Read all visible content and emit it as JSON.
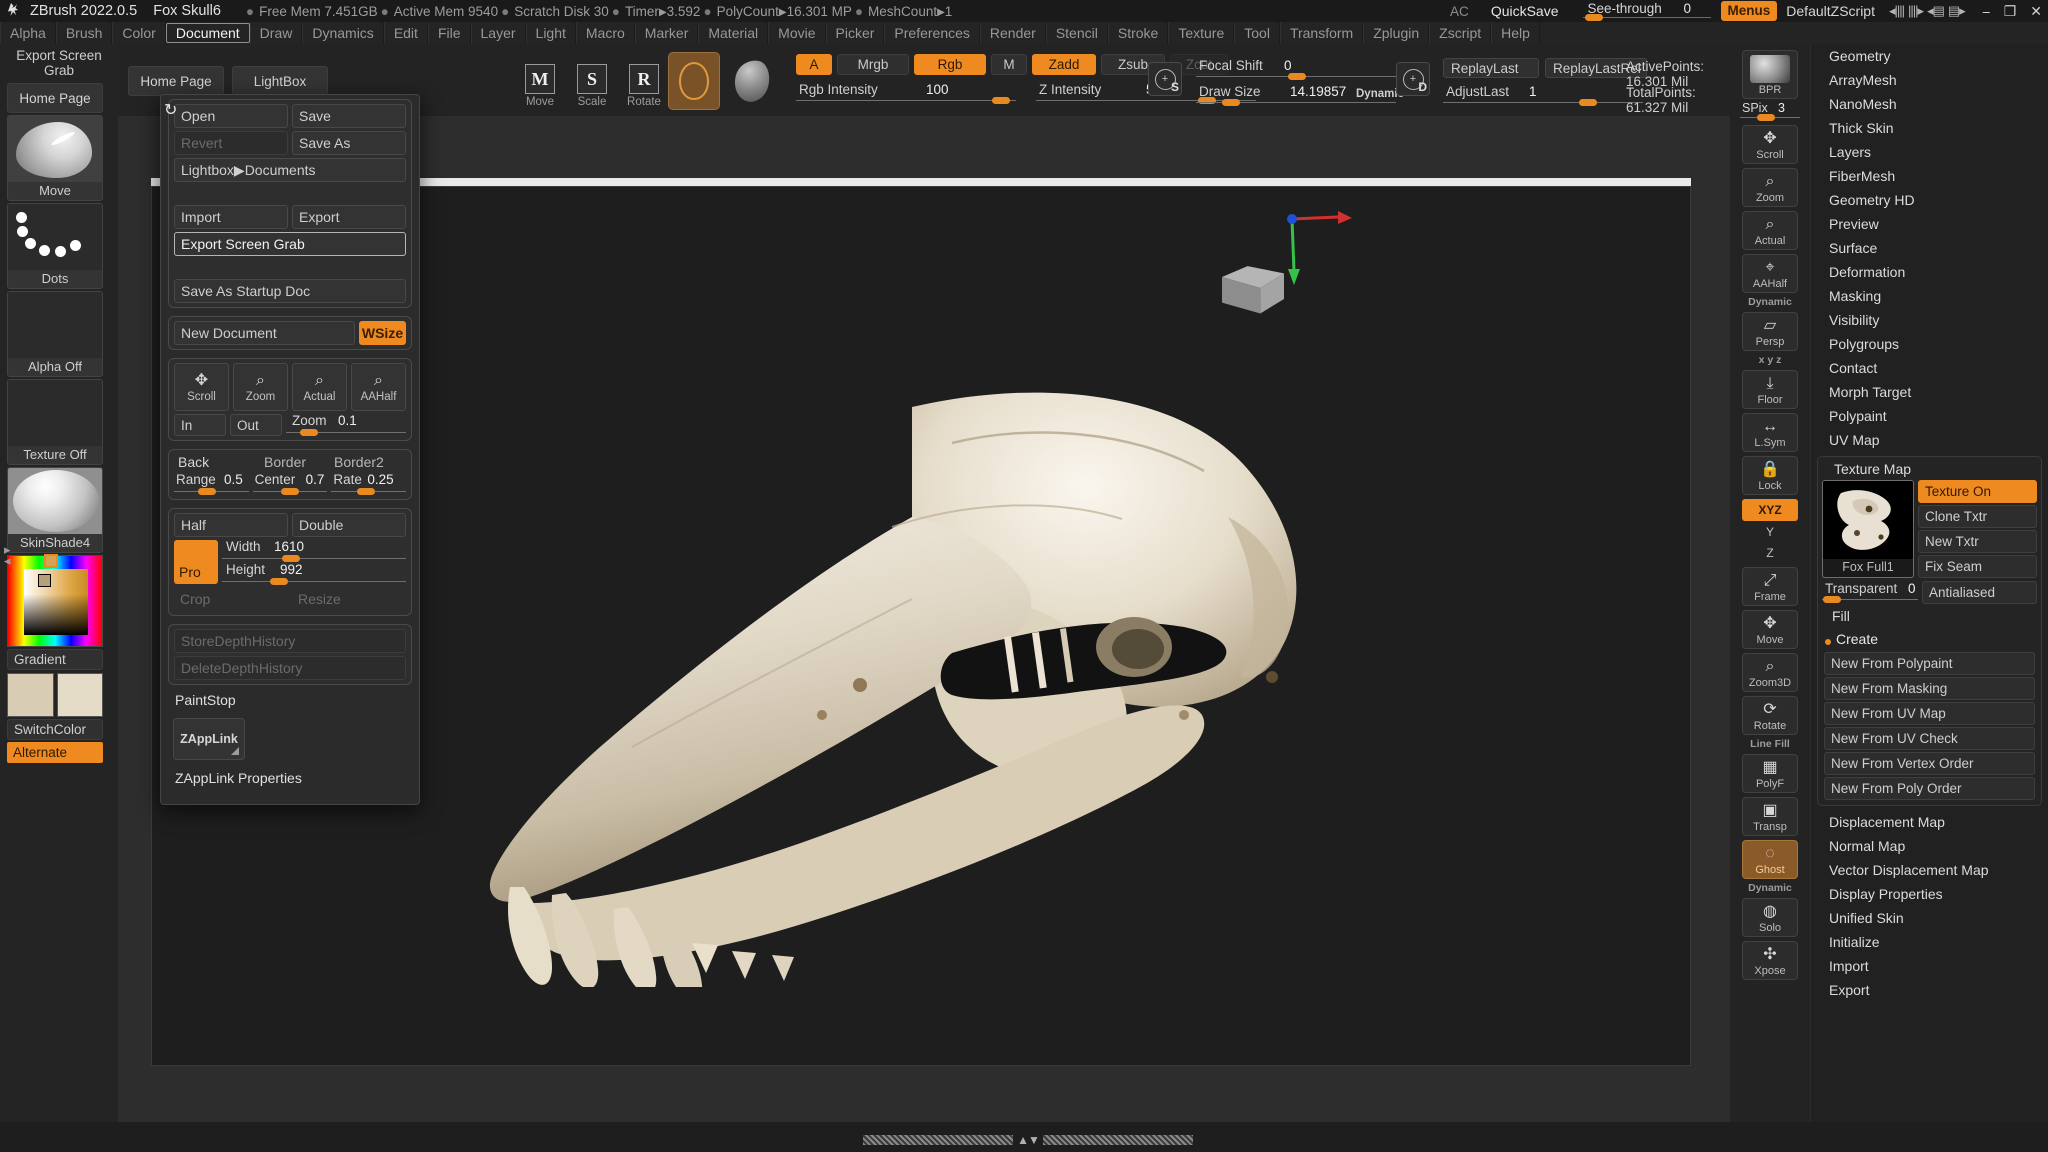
{
  "titlebar": {
    "app": "ZBrush 2022.0.5",
    "document": "Fox Skull6",
    "stats": [
      {
        "label": "Free Mem",
        "value": "7.451GB",
        "arrow": false
      },
      {
        "label": "Active Mem",
        "value": "9540",
        "arrow": false
      },
      {
        "label": "Scratch Disk",
        "value": "30",
        "arrow": false
      },
      {
        "label": "Timer",
        "value": "3.592",
        "arrow": true
      },
      {
        "label": "PolyCount",
        "value": "16.301 MP",
        "arrow": true
      },
      {
        "label": "MeshCount",
        "value": "1",
        "arrow": true
      }
    ],
    "ac": "AC",
    "quicksave": "QuickSave",
    "seethrough_label": "See-through",
    "seethrough_value": "0",
    "menus_button": "Menus",
    "zscript": "DefaultZScript"
  },
  "menubar": {
    "items": [
      "Alpha",
      "Brush",
      "Color",
      "Document",
      "Draw",
      "Dynamics",
      "Edit",
      "File",
      "Layer",
      "Light",
      "Macro",
      "Marker",
      "Material",
      "Movie",
      "Picker",
      "Preferences",
      "Render",
      "Stencil",
      "Stroke",
      "Texture",
      "Tool",
      "Transform",
      "Zplugin",
      "Zscript",
      "Help"
    ],
    "active": "Document"
  },
  "left_shelf": {
    "title": "Export Screen Grab",
    "home_page": "Home Page",
    "brush": "Move",
    "stroke": "Dots",
    "alpha": "Alpha Off",
    "texture": "Texture Off",
    "material": "SkinShade4",
    "gradient": "Gradient",
    "switch_color": "SwitchColor",
    "alternate": "Alternate"
  },
  "tool_shelf": {
    "tabs": [
      "Home Page",
      "LightBox"
    ],
    "transforms": [
      {
        "glyph": "M",
        "label": "Move"
      },
      {
        "glyph": "S",
        "label": "Scale"
      },
      {
        "glyph": "R",
        "label": "Rotate"
      }
    ],
    "modes": [
      {
        "label": "A",
        "on": true
      },
      {
        "label": "Mrgb",
        "on": false
      },
      {
        "label": "Rgb",
        "on": true
      },
      {
        "label": "M",
        "on": false
      },
      {
        "label": "Zadd",
        "on": true
      },
      {
        "label": "Zsub",
        "on": false
      },
      {
        "label": "Zcut",
        "on": false,
        "dim": true
      }
    ],
    "sliders": [
      {
        "label": "Rgb Intensity",
        "value": "100",
        "fill": 0.97
      },
      {
        "label": "Z Intensity",
        "value": "51",
        "fill": 0.8
      },
      {
        "label": "Focal Shift",
        "value": "0",
        "fill": 0.5
      },
      {
        "label": "Draw Size",
        "value": "14.19857",
        "fill": 0.1
      },
      {
        "label": "AdjustLast",
        "value": "1",
        "fill": 0.7
      }
    ],
    "dynamic_label": "Dynamic",
    "stroke_buttons": [
      "ReplayLast",
      "ReplayLastRel"
    ],
    "point_stats": [
      "ActivePoints: 16.301 Mil",
      "TotalPoints: 61.327 Mil"
    ]
  },
  "document_menu": {
    "refresh_icon": "refresh-icon",
    "rows": [
      {
        "type": "pair",
        "left": {
          "label": "Open",
          "disabled": false
        },
        "right": {
          "label": "Save",
          "disabled": false
        }
      },
      {
        "type": "pair",
        "left": {
          "label": "Revert",
          "disabled": true
        },
        "right": {
          "label": "Save As",
          "disabled": false
        }
      },
      {
        "type": "wide",
        "label": "Lightbox▶Documents",
        "disabled": false
      },
      {
        "type": "gap"
      },
      {
        "type": "pair",
        "left": {
          "label": "Import",
          "disabled": false
        },
        "right": {
          "label": "Export",
          "disabled": false
        }
      },
      {
        "type": "wide",
        "label": "Export Screen Grab",
        "selected": true
      },
      {
        "type": "gap"
      },
      {
        "type": "wide",
        "label": "Save As Startup Doc",
        "disabled": false
      }
    ],
    "new_document": "New Document",
    "wsize": "WSize",
    "view_buttons": [
      {
        "label": "Scroll",
        "icon": "scroll-icon"
      },
      {
        "label": "Zoom",
        "icon": "zoom-icon"
      },
      {
        "label": "Actual",
        "icon": "actual-size-icon"
      },
      {
        "label": "AAHalf",
        "icon": "aahalf-icon"
      }
    ],
    "in_label": "In",
    "out_label": "Out",
    "zoom_label": "Zoom",
    "zoom_value": "0.1",
    "back_label": "Back",
    "border_label": "Border",
    "border2_label": "Border2",
    "range_label": "Range",
    "range_value": "0.5",
    "center_label": "Center",
    "center_value": "0.7",
    "rate_label": "Rate",
    "rate_value": "0.25",
    "half_label": "Half",
    "double_label": "Double",
    "pro_label": "Pro",
    "width_label": "Width",
    "width_value": "1610",
    "height_label": "Height",
    "height_value": "992",
    "crop_label": "Crop",
    "resize_label": "Resize",
    "store_depth": "StoreDepthHistory",
    "delete_depth": "DeleteDepthHistory",
    "paintstop": "PaintStop",
    "zapplink": "ZAppLink",
    "zapplink_props": "ZAppLink Properties"
  },
  "right_toolbar": {
    "bpr": "BPR",
    "spix_label": "SPix",
    "spix_value": "3",
    "buttons": [
      {
        "label": "Scroll",
        "icon": "scroll-icon",
        "on": false
      },
      {
        "label": "Zoom",
        "icon": "zoom-icon",
        "on": false
      },
      {
        "label": "Actual",
        "icon": "actual-size-icon",
        "on": false
      },
      {
        "label": "AAHalf",
        "icon": "aahalf-icon",
        "on": false
      },
      {
        "label": "Persp",
        "icon": "perspective-icon",
        "on": false,
        "top": "Dynamic"
      },
      {
        "label": "Floor",
        "icon": "floor-icon",
        "on": false,
        "top": "x y z"
      },
      {
        "label": "L.Sym",
        "icon": "local-symmetry-icon",
        "on": false
      },
      {
        "label": "Lock",
        "icon": "lock-icon",
        "on": false
      }
    ],
    "xyz": "XYZ",
    "y_axis": "Y",
    "z_axis": "Z",
    "buttons2": [
      {
        "label": "Frame",
        "icon": "frame-icon",
        "on": false
      },
      {
        "label": "Move",
        "icon": "move-icon",
        "on": false
      },
      {
        "label": "Zoom3D",
        "icon": "zoom3d-icon",
        "on": false
      },
      {
        "label": "Rotate",
        "icon": "rotate-icon",
        "on": false
      },
      {
        "label": "PolyF",
        "icon": "polyframe-icon",
        "on": false,
        "top": "Line Fill"
      },
      {
        "label": "Transp",
        "icon": "transparency-icon",
        "on": false
      },
      {
        "label": "Ghost",
        "icon": "ghost-icon",
        "on": true
      },
      {
        "label": "Solo",
        "icon": "solo-icon",
        "on": false,
        "top": "Dynamic"
      },
      {
        "label": "Xpose",
        "icon": "xpose-icon",
        "on": false
      }
    ]
  },
  "right_panel": {
    "top_items": [
      "Geometry",
      "ArrayMesh",
      "NanoMesh",
      "Thick Skin",
      "Layers",
      "FiberMesh",
      "Geometry HD",
      "Preview",
      "Surface",
      "Deformation",
      "Masking",
      "Visibility",
      "Polygroups",
      "Contact",
      "Morph Target",
      "Polypaint",
      "UV Map"
    ],
    "texture_map": {
      "title": "Texture Map",
      "thumb_caption": "Fox Full1",
      "buttons": [
        {
          "label": "Texture On",
          "on": true
        },
        {
          "label": "Clone Txtr",
          "on": false
        },
        {
          "label": "New Txtr",
          "on": false
        },
        {
          "label": "Fix Seam",
          "on": false
        },
        {
          "label": "Antialiased",
          "on": false
        }
      ],
      "transparent_label": "Transparent",
      "transparent_value": "0",
      "fill": "Fill",
      "create": "Create",
      "create_buttons": [
        "New From Polypaint",
        "New From Masking",
        "New From UV Map",
        "New From UV Check",
        "New From Vertex Order",
        "New From Poly Order"
      ]
    },
    "bottom_items": [
      "Displacement Map",
      "Normal Map",
      "Vector Displacement Map",
      "Display Properties",
      "Unified Skin",
      "Initialize",
      "Import",
      "Export"
    ]
  },
  "colors": {
    "accent": "#ef8a21",
    "panel": "#242424",
    "canvas": "#1e1e1e",
    "text": "#cfcfcf"
  }
}
